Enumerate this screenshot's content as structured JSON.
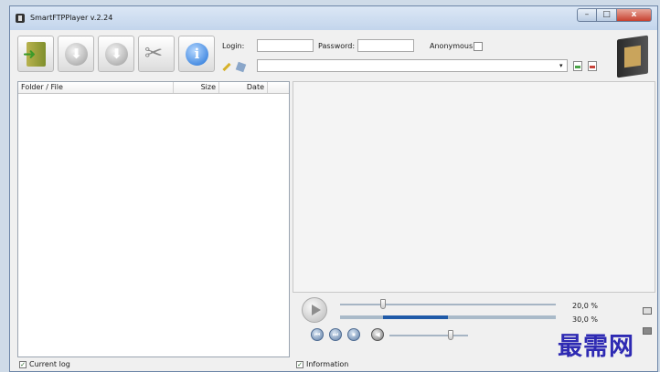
{
  "window": {
    "title": "SmartFTPPlayer v.2.24",
    "minimize": "–",
    "maximize": "□",
    "close": "x"
  },
  "toolbar": {
    "buttons": [
      {
        "name": "exit-button",
        "icon": "exit-door-icon"
      },
      {
        "name": "download-button",
        "icon": "arrow-down-icon",
        "glyph": "⬇"
      },
      {
        "name": "download-all-button",
        "icon": "arrow-down-icon",
        "glyph": "⬇"
      },
      {
        "name": "settings-button",
        "icon": "tools-icon",
        "glyph": "✂"
      },
      {
        "name": "info-button",
        "icon": "info-icon",
        "glyph": "i"
      }
    ],
    "login_label": "Login:",
    "login_value": "",
    "password_label": "Password:",
    "password_value": "",
    "anonymous_label": "Anonymous",
    "anonymous_checked": false,
    "address_value": "",
    "dropdown_glyph": "▾"
  },
  "file_list": {
    "columns": [
      "Folder / File",
      "Size",
      "Date"
    ]
  },
  "player": {
    "position_percent": "20,0 %",
    "volume_percent": "30,0 %",
    "seek_fraction": 0.2,
    "volume_fraction": 0.3,
    "progress_start_fraction": 0.2,
    "progress_end_fraction": 0.5,
    "controls": [
      {
        "name": "previous-button",
        "glyph": "⏮"
      },
      {
        "name": "next-button",
        "glyph": "⏭"
      },
      {
        "name": "stop-button",
        "glyph": "⏹"
      },
      {
        "name": "mute-button",
        "glyph": "◀"
      }
    ]
  },
  "status": {
    "current_log_label": "Current log",
    "current_log_checked": true,
    "information_label": "Information",
    "information_checked": true,
    "check_glyph": "✓"
  },
  "watermark": "最需网"
}
